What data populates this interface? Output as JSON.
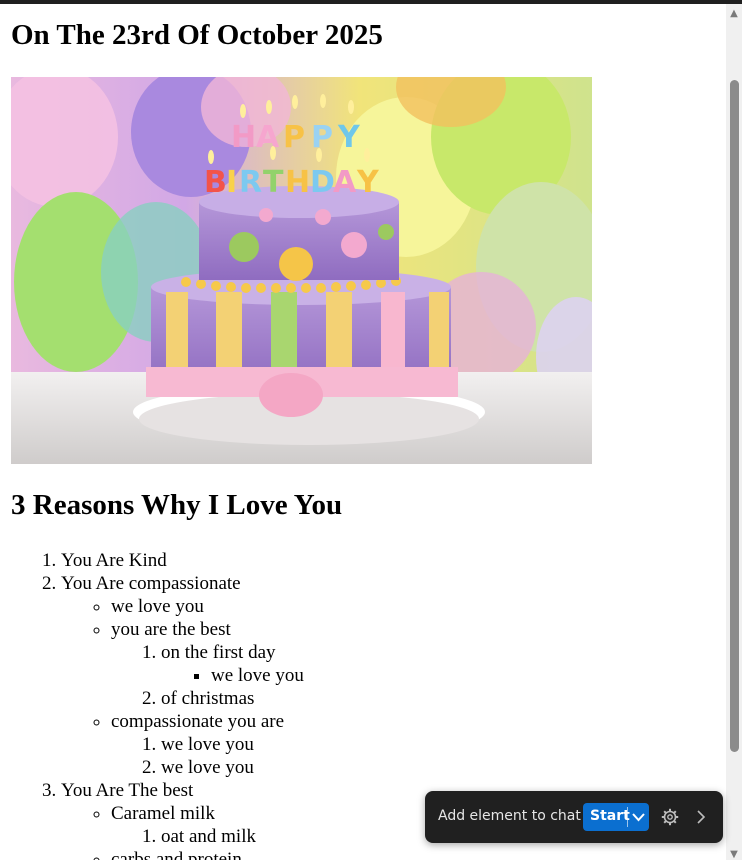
{
  "page": {
    "title": "On The 23rd Of October 2025",
    "hero_image": "birthday-cake-image",
    "hero_text": "HAPPY BIRTHDAY",
    "section_heading": "3 Reasons Why I Love You"
  },
  "reasons": {
    "r1": "You Are Kind",
    "r2": "You Are compassionate",
    "r2a": "we love you",
    "r2b": "you are the best",
    "r2b1": "on the first day",
    "r2b1a": "we love you",
    "r2b2": "of christmas",
    "r2c": "compassionate you are",
    "r2c1": "we love you",
    "r2c2": "we love you",
    "r3": "You Are The best",
    "r3a": "Caramel milk",
    "r3a1": "oat and milk",
    "r3b": "carbs and protein"
  },
  "toolbar": {
    "add_label": "Add element to chat",
    "start_label": "Start",
    "dropdown_icon": "chevron-down-icon",
    "settings_icon": "gear-icon",
    "expand_icon": "chevron-right-icon"
  },
  "colors": {
    "toolbar_bg": "#202020",
    "start_button": "#0b6fd0",
    "scrollbar_thumb": "#8b8b8b"
  }
}
